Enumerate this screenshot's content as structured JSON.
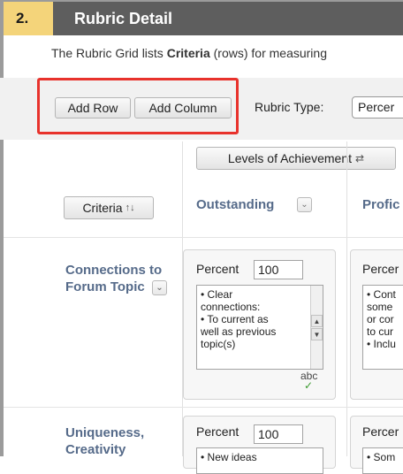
{
  "section": {
    "step_number": "2.",
    "title": "Rubric Detail",
    "description": "The Rubric Grid lists Criteria (rows) for measuring"
  },
  "toolbar": {
    "add_row_label": "Add Row",
    "add_column_label": "Add Column",
    "rubric_type_label": "Rubric Type:",
    "rubric_type_value": "Percer",
    "levels_button_label": "Levels of Achievement"
  },
  "grid": {
    "criteria_header_label": "Criteria",
    "columns": [
      {
        "label": "Outstanding"
      },
      {
        "label": "Profic"
      }
    ],
    "rows": [
      {
        "title": "Connections to Forum Topic",
        "cells": [
          {
            "percent_label": "Percent",
            "percent_value": "100",
            "text": "• Clear\nconnections:\n• To current as\nwell as previous\ntopic(s)"
          },
          {
            "percent_label": "Percer",
            "percent_value": "",
            "text": "• Cont\nsome\nor cor\nto cur\n• Inclu"
          }
        ]
      },
      {
        "title": "Uniqueness, Creativity",
        "cells": [
          {
            "percent_label": "Percent",
            "percent_value": "100",
            "text": "• New ideas"
          },
          {
            "percent_label": "Percer",
            "percent_value": "",
            "text": "• Som"
          }
        ]
      }
    ]
  },
  "spellcheck_label": "abc",
  "colors": {
    "header_bg": "#5e5e5e",
    "step_bg": "#f4d47a",
    "highlight": "#e8322c",
    "link_blue": "#566b8a"
  }
}
